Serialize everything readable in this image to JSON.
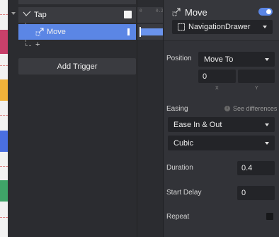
{
  "colors": {
    "accent": "#5b86e5",
    "panel_bg": "#323338",
    "field_bg": "#232428",
    "row_bg": "#3a3b40"
  },
  "icons": {
    "collapse": "chevron-down-icon",
    "tap": "tap-gesture-icon",
    "move": "move-arrow-icon",
    "layer": "navigation-drawer-layer-icon",
    "info": "info-icon"
  },
  "triggers": {
    "tap_label": "Tap",
    "tap_enabled": true,
    "move_label": "Move",
    "add_symbol": "+",
    "add_trigger_label": "Add Trigger"
  },
  "timeline": {
    "ticks": [
      "0",
      "0.2"
    ]
  },
  "properties": {
    "title": "Move",
    "enabled": true,
    "target_layer": "NavigationDrawer",
    "position_label": "Position",
    "position_mode": "Move To",
    "x_value": "0",
    "y_value": "",
    "x_label": "X",
    "y_label": "Y",
    "easing_label": "Easing",
    "see_differences": "See differences",
    "easing_mode": "Ease In & Out",
    "easing_curve": "Cubic",
    "duration_label": "Duration",
    "duration_value": "0.4",
    "start_delay_label": "Start Delay",
    "start_delay_value": "0",
    "repeat_label": "Repeat",
    "repeat_checked": false
  }
}
